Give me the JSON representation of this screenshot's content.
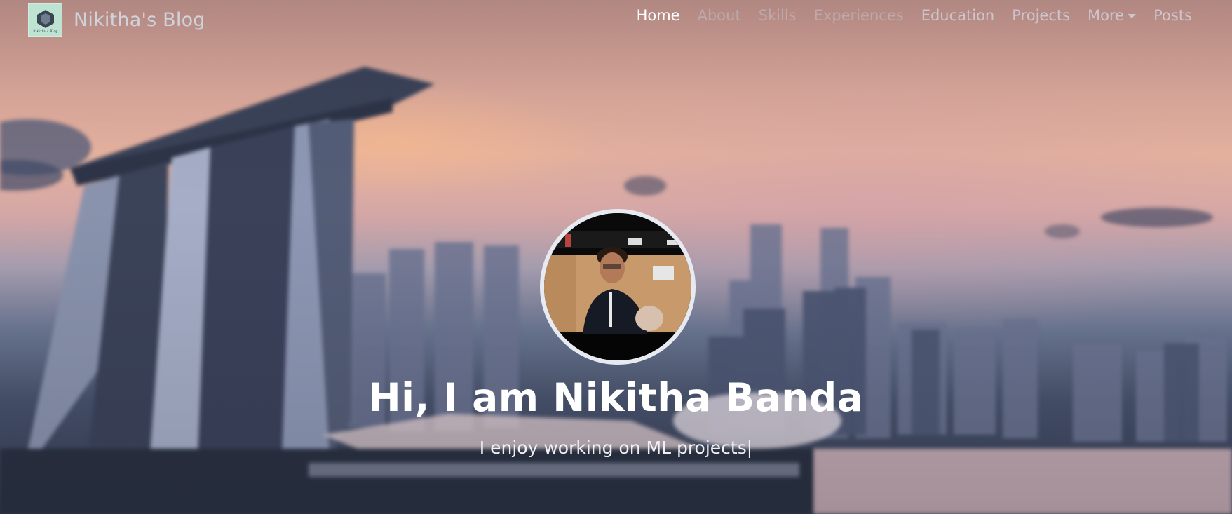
{
  "brand": {
    "logo_text": "Nikitha's Blog",
    "name": "Nikitha's Blog"
  },
  "nav": {
    "items": [
      {
        "label": "Home",
        "state": "active"
      },
      {
        "label": "About",
        "state": "dim"
      },
      {
        "label": "Skills",
        "state": "dim"
      },
      {
        "label": "Experiences",
        "state": "dim"
      },
      {
        "label": "Education",
        "state": "normal"
      },
      {
        "label": "Projects",
        "state": "normal"
      },
      {
        "label": "More",
        "state": "normal",
        "dropdown": true
      },
      {
        "label": "Posts",
        "state": "normal"
      }
    ]
  },
  "hero": {
    "headline": "Hi, I am Nikitha Banda",
    "typing_text": "I enjoy working on ML projects",
    "cursor": "|"
  },
  "colors": {
    "nav_active": "#ffffff",
    "nav_text": "#d2d6e2",
    "avatar_border": "#e8eaf2"
  },
  "icons": {
    "logo": "hexagon-cube-icon",
    "dropdown": "caret-down-icon"
  }
}
